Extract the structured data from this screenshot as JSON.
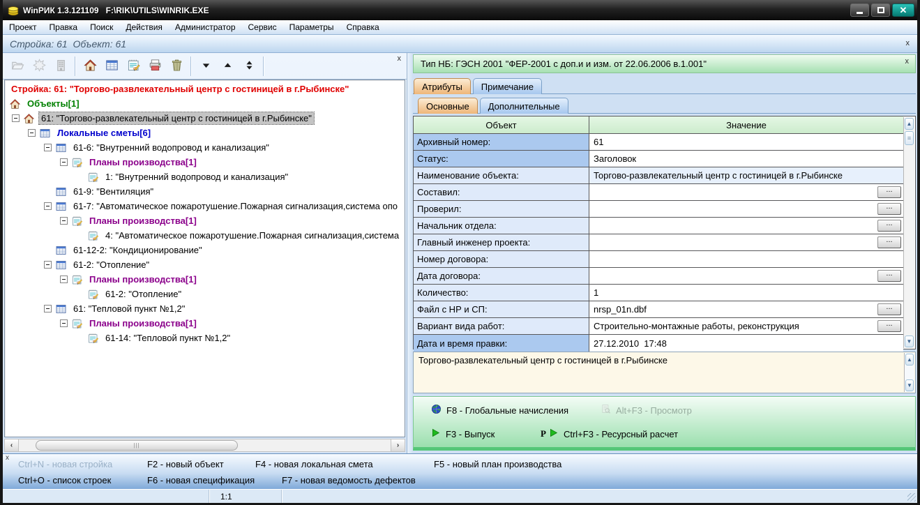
{
  "window": {
    "title": "WinРИК 1.3.121109   F:\\RIK\\UTILS\\WINRIK.EXE"
  },
  "menu": {
    "items": [
      "Проект",
      "Правка",
      "Поиск",
      "Действия",
      "Администратор",
      "Сервис",
      "Параметры",
      "Справка"
    ]
  },
  "infobar": {
    "text": "Стройка: 61  Объект: 61"
  },
  "colors": {
    "close_button": "#0f9b94",
    "tree_root": "#e00000",
    "tree_objects_group": "#008000",
    "tree_smety_group": "#0000cc",
    "tree_plans_group": "#8b008b",
    "tab_active": "#eeb679",
    "panel_green": "#a6e0b2",
    "label_strong": "#abc9ef",
    "label_light": "#dfeafa"
  },
  "left_toolbar": {
    "buttons": [
      {
        "icon": "open-folder-icon",
        "disabled": true
      },
      {
        "icon": "new-project-icon",
        "disabled": true
      },
      {
        "icon": "building-icon",
        "disabled": true
      },
      {
        "icon": "house-icon",
        "disabled": false
      },
      {
        "icon": "spreadsheet-icon",
        "disabled": false
      },
      {
        "icon": "plan-icon",
        "disabled": false
      },
      {
        "icon": "print-icon",
        "disabled": false
      },
      {
        "icon": "trash-icon",
        "disabled": false
      },
      {
        "icon": "move-down-icon",
        "disabled": false
      },
      {
        "icon": "move-up-icon",
        "disabled": false
      },
      {
        "icon": "move-updown-icon",
        "disabled": false
      }
    ],
    "groups": [
      [
        0,
        1,
        2
      ],
      [
        3,
        4,
        5,
        6,
        7
      ],
      [
        8,
        9,
        10
      ]
    ]
  },
  "tree": {
    "items": [
      {
        "level": 0,
        "icon": null,
        "expander": false,
        "style": "root",
        "text": "Стройка: 61: \"Торгово-развлекательный центр с гостиницей в г.Рыбинске\""
      },
      {
        "level": 0,
        "icon": "house",
        "expander": false,
        "style": "group-green",
        "text": "Объекты[1]"
      },
      {
        "level": 1,
        "icon": "house",
        "expander": true,
        "style": "selected",
        "text": "61: \"Торгово-развлекательный центр с гостиницей в г.Рыбинске\""
      },
      {
        "level": 2,
        "icon": "sheet",
        "expander": true,
        "style": "group-blue",
        "text": "Локальные сметы[6]"
      },
      {
        "level": 3,
        "icon": "sheet",
        "expander": true,
        "style": "normal",
        "text": "61-6: \"Внутренний водопровод и канализация\""
      },
      {
        "level": 4,
        "icon": "plan",
        "expander": true,
        "style": "group-purple",
        "text": "Планы производства[1]"
      },
      {
        "level": 5,
        "icon": "plan",
        "expander": false,
        "style": "normal",
        "text": "1: \"Внутренний водопровод и канализация\""
      },
      {
        "level": 3,
        "icon": "sheet",
        "expander": false,
        "style": "normal",
        "text": "61-9: \"Вентиляция\""
      },
      {
        "level": 3,
        "icon": "sheet",
        "expander": true,
        "style": "normal",
        "text": "61-7: \"Автоматическое пожаротушение.Пожарная сигнализация,система опо"
      },
      {
        "level": 4,
        "icon": "plan",
        "expander": true,
        "style": "group-purple",
        "text": "Планы производства[1]"
      },
      {
        "level": 5,
        "icon": "plan",
        "expander": false,
        "style": "normal",
        "text": "4: \"Автоматическое пожаротушение.Пожарная сигнализация,система"
      },
      {
        "level": 3,
        "icon": "sheet",
        "expander": false,
        "style": "normal",
        "text": "61-12-2: \"Кондиционирование\""
      },
      {
        "level": 3,
        "icon": "sheet",
        "expander": true,
        "style": "normal",
        "text": "61-2: \"Отопление\""
      },
      {
        "level": 4,
        "icon": "plan",
        "expander": true,
        "style": "group-purple",
        "text": "Планы производства[1]"
      },
      {
        "level": 5,
        "icon": "plan",
        "expander": false,
        "style": "normal",
        "text": "61-2: \"Отопление\""
      },
      {
        "level": 3,
        "icon": "sheet",
        "expander": true,
        "style": "normal",
        "text": "61: \"Тепловой пункт №1,2\""
      },
      {
        "level": 4,
        "icon": "plan",
        "expander": true,
        "style": "group-purple",
        "text": "Планы производства[1]"
      },
      {
        "level": 5,
        "icon": "plan",
        "expander": false,
        "style": "normal",
        "text": "61-14: \"Тепловой пункт №1,2\""
      }
    ]
  },
  "right": {
    "nb_header": "Тип НБ: ГЭСН 2001 \"ФЕР-2001 с доп.и и изм. от 22.06.2006 в.1.001\"",
    "tabs": [
      {
        "label": "Атрибуты",
        "active": true
      },
      {
        "label": "Примечание",
        "active": false
      }
    ],
    "subtabs": [
      {
        "label": "Основные",
        "active": true
      },
      {
        "label": "Дополнительные",
        "active": false
      }
    ],
    "table": {
      "headers": [
        "Объект",
        "Значение"
      ],
      "rows": [
        {
          "label": "Архивный номер:",
          "value": "61",
          "strong": true,
          "button": false,
          "tint": false
        },
        {
          "label": "Статус:",
          "value": "Заголовок",
          "strong": true,
          "button": false,
          "tint": false
        },
        {
          "label": "Наименование объекта:",
          "value": "Торгово-развлекательный центр с гостиницей в г.Рыбинске",
          "strong": false,
          "button": false,
          "tint": true
        },
        {
          "label": "Составил:",
          "value": "",
          "strong": false,
          "button": true,
          "tint": false
        },
        {
          "label": "Проверил:",
          "value": "",
          "strong": false,
          "button": true,
          "tint": false
        },
        {
          "label": "Начальник отдела:",
          "value": "",
          "strong": false,
          "button": true,
          "tint": false
        },
        {
          "label": "Главный инженер проекта:",
          "value": "",
          "strong": false,
          "button": true,
          "tint": false
        },
        {
          "label": "Номер договора:",
          "value": "",
          "strong": false,
          "button": false,
          "tint": false
        },
        {
          "label": "Дата договора:",
          "value": "",
          "strong": false,
          "button": true,
          "tint": false
        },
        {
          "label": "Количество:",
          "value": "1",
          "strong": false,
          "button": false,
          "tint": false
        },
        {
          "label": "Файл с НР и СП:",
          "value": "nrsp_01n.dbf",
          "strong": false,
          "button": true,
          "tint": false
        },
        {
          "label": "Вариант вида работ:",
          "value": "Строительно-монтажные работы, реконструкция",
          "strong": false,
          "button": true,
          "tint": false
        },
        {
          "label": "Дата и время правки:",
          "value": "27.12.2010  17:48",
          "strong": true,
          "button": false,
          "tint": false
        }
      ]
    },
    "memo": "Торгово-развлекательный центр с гостиницей в г.Рыбинске",
    "fkeys": [
      {
        "icon": "globe-icon",
        "label": "F8 - Глобальные начисления",
        "disabled": false,
        "prefix": ""
      },
      {
        "icon": "preview-icon",
        "label": "Alt+F3 - Просмотр",
        "disabled": true,
        "prefix": ""
      },
      {
        "icon": "play-icon",
        "label": "F3 - Выпуск",
        "disabled": false,
        "prefix": ""
      },
      {
        "icon": "play-icon",
        "label": "Ctrl+F3 - Ресурсный расчет",
        "disabled": false,
        "prefix": "P"
      }
    ]
  },
  "hintbar": {
    "row1": [
      {
        "label": "Ctrl+N - новая стройка",
        "disabled": true
      },
      {
        "label": "F2 - новый объект",
        "disabled": false
      },
      {
        "label": "F4 - новая локальная смета",
        "disabled": false
      },
      {
        "label": "F5 - новый план производства",
        "disabled": false
      }
    ],
    "row2": [
      {
        "label": "Ctrl+O - список строек",
        "disabled": false
      },
      {
        "label": "F6 - новая спецификация",
        "disabled": false
      },
      {
        "label": "F7 - новая ведомость дефектов",
        "disabled": false
      }
    ]
  },
  "statusbar": {
    "zoom": "1:1"
  }
}
